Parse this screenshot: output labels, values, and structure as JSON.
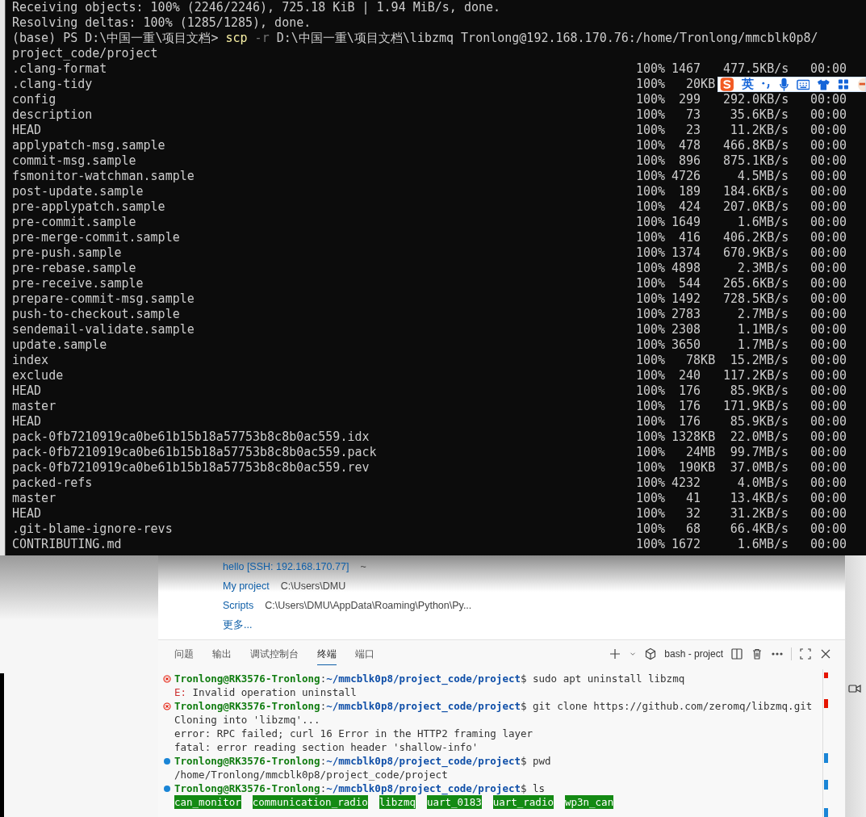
{
  "console": {
    "lines": [
      [
        {
          "kind": "plain",
          "text": "Receiving objects: 100% (2246/2246), 725.18 KiB | 1.94 MiB/s, done."
        }
      ],
      [
        {
          "kind": "plain",
          "text": "Resolving deltas: 100% (1285/1285), done."
        }
      ],
      [
        {
          "kind": "plain",
          "text": "(base) PS D:\\中国一重\\项目文档> "
        },
        {
          "kind": "command",
          "text": "scp"
        },
        {
          "kind": "flag",
          "text": " -r"
        },
        {
          "kind": "plain",
          "text": " D:\\中国一重\\项目文档\\libzmq Tronlong@192.168.170.76:/home/Tronlong/mmcblk0p8/"
        }
      ],
      [
        {
          "kind": "plain",
          "text": "project_code/project"
        }
      ]
    ],
    "transfers": [
      {
        "name": ".clang-format",
        "percent": "100%",
        "size": "1467",
        "speed": "477.5KB/s",
        "eta": "00:00"
      },
      {
        "name": ".clang-tidy",
        "percent": "100%",
        "size": "  20KB"
      },
      {
        "name": "config",
        "percent": "100%",
        "size": " 299",
        "speed": "292.0KB/s",
        "eta": "00:00"
      },
      {
        "name": "description",
        "percent": "100%",
        "size": "  73",
        "speed": "35.6KB/s",
        "eta": "00:00"
      },
      {
        "name": "HEAD",
        "percent": "100%",
        "size": "  23",
        "speed": "11.2KB/s",
        "eta": "00:00"
      },
      {
        "name": "applypatch-msg.sample",
        "percent": "100%",
        "size": " 478",
        "speed": "466.8KB/s",
        "eta": "00:00"
      },
      {
        "name": "commit-msg.sample",
        "percent": "100%",
        "size": " 896",
        "speed": "875.1KB/s",
        "eta": "00:00"
      },
      {
        "name": "fsmonitor-watchman.sample",
        "percent": "100%",
        "size": "4726",
        "speed": "4.5MB/s",
        "eta": "00:00"
      },
      {
        "name": "post-update.sample",
        "percent": "100%",
        "size": " 189",
        "speed": "184.6KB/s",
        "eta": "00:00"
      },
      {
        "name": "pre-applypatch.sample",
        "percent": "100%",
        "size": " 424",
        "speed": "207.0KB/s",
        "eta": "00:00"
      },
      {
        "name": "pre-commit.sample",
        "percent": "100%",
        "size": "1649",
        "speed": "1.6MB/s",
        "eta": "00:00"
      },
      {
        "name": "pre-merge-commit.sample",
        "percent": "100%",
        "size": " 416",
        "speed": "406.2KB/s",
        "eta": "00:00"
      },
      {
        "name": "pre-push.sample",
        "percent": "100%",
        "size": "1374",
        "speed": "670.9KB/s",
        "eta": "00:00"
      },
      {
        "name": "pre-rebase.sample",
        "percent": "100%",
        "size": "4898",
        "speed": "2.3MB/s",
        "eta": "00:00"
      },
      {
        "name": "pre-receive.sample",
        "percent": "100%",
        "size": " 544",
        "speed": "265.6KB/s",
        "eta": "00:00"
      },
      {
        "name": "prepare-commit-msg.sample",
        "percent": "100%",
        "size": "1492",
        "speed": "728.5KB/s",
        "eta": "00:00"
      },
      {
        "name": "push-to-checkout.sample",
        "percent": "100%",
        "size": "2783",
        "speed": "2.7MB/s",
        "eta": "00:00"
      },
      {
        "name": "sendemail-validate.sample",
        "percent": "100%",
        "size": "2308",
        "speed": "1.1MB/s",
        "eta": "00:00"
      },
      {
        "name": "update.sample",
        "percent": "100%",
        "size": "3650",
        "speed": "1.7MB/s",
        "eta": "00:00"
      },
      {
        "name": "index",
        "percent": "100%",
        "size": "  78KB",
        "speed": "15.2MB/s",
        "eta": "00:00"
      },
      {
        "name": "exclude",
        "percent": "100%",
        "size": " 240",
        "speed": "117.2KB/s",
        "eta": "00:00"
      },
      {
        "name": "HEAD",
        "percent": "100%",
        "size": " 176",
        "speed": "85.9KB/s",
        "eta": "00:00"
      },
      {
        "name": "master",
        "percent": "100%",
        "size": " 176",
        "speed": "171.9KB/s",
        "eta": "00:00"
      },
      {
        "name": "HEAD",
        "percent": "100%",
        "size": " 176",
        "speed": "85.9KB/s",
        "eta": "00:00"
      },
      {
        "name": "pack-0fb7210919ca0be61b15b18a57753b8c8b0ac559.idx",
        "percent": "100%",
        "size": "1328KB",
        "speed": "22.0MB/s",
        "eta": "00:00"
      },
      {
        "name": "pack-0fb7210919ca0be61b15b18a57753b8c8b0ac559.pack",
        "percent": "100%",
        "size": "  24MB",
        "speed": "99.7MB/s",
        "eta": "00:00"
      },
      {
        "name": "pack-0fb7210919ca0be61b15b18a57753b8c8b0ac559.rev",
        "percent": "100%",
        "size": " 190KB",
        "speed": "37.0MB/s",
        "eta": "00:00"
      },
      {
        "name": "packed-refs",
        "percent": "100%",
        "size": "4232",
        "speed": "4.0MB/s",
        "eta": "00:00"
      },
      {
        "name": "master",
        "percent": "100%",
        "size": "  41",
        "speed": "13.4KB/s",
        "eta": "00:00"
      },
      {
        "name": "HEAD",
        "percent": "100%",
        "size": "  32",
        "speed": "31.2KB/s",
        "eta": "00:00"
      },
      {
        "name": ".git-blame-ignore-revs",
        "percent": "100%",
        "size": "  68",
        "speed": "66.4KB/s",
        "eta": "00:00"
      },
      {
        "name": "CONTRIBUTING.md",
        "percent": "100%",
        "size": "1672",
        "speed": "1.6MB/s",
        "eta": "00:00"
      }
    ]
  },
  "ime_toolbar": {
    "mode": "英"
  },
  "editor": {
    "recent": [
      {
        "name": "hello [SSH: 192.168.170.77]",
        "path": "~"
      },
      {
        "name": "My project",
        "path": "C:\\Users\\DMU"
      },
      {
        "name": "Scripts",
        "path": "C:\\Users\\DMU\\AppData\\Roaming\\Python\\Py..."
      }
    ],
    "more": "更多...",
    "panel_tabs": [
      {
        "label": "问题",
        "selected": false
      },
      {
        "label": "输出",
        "selected": false
      },
      {
        "label": "调试控制台",
        "selected": false
      },
      {
        "label": "终端",
        "selected": true
      },
      {
        "label": "端口",
        "selected": false
      }
    ],
    "terminal_name": "bash - project",
    "terminal_lines": [
      {
        "kind": "prompt",
        "failed": true,
        "segments": [
          {
            "kind": "user",
            "text": "Tronlong@RK3576-Tronlong"
          },
          {
            "kind": "sep",
            "text": ":"
          },
          {
            "kind": "path",
            "text": "~/mmcblk0p8/project_code/project"
          },
          {
            "kind": "plain",
            "text": "$ sudo apt uninstall libzmq"
          }
        ]
      },
      {
        "kind": "output",
        "segments": [
          {
            "kind": "err",
            "text": "E:"
          },
          {
            "kind": "plain",
            "text": " Invalid operation uninstall"
          }
        ]
      },
      {
        "kind": "prompt",
        "failed": true,
        "segments": [
          {
            "kind": "user",
            "text": "Tronlong@RK3576-Tronlong"
          },
          {
            "kind": "sep",
            "text": ":"
          },
          {
            "kind": "path",
            "text": "~/mmcblk0p8/project_code/project"
          },
          {
            "kind": "plain",
            "text": "$ git clone https://github.com/zeromq/libzmq.git"
          }
        ]
      },
      {
        "kind": "output",
        "segments": [
          {
            "kind": "plain",
            "text": "Cloning into 'libzmq'..."
          }
        ]
      },
      {
        "kind": "output",
        "segments": [
          {
            "kind": "plain",
            "text": "error: RPC failed; curl 16 Error in the HTTP2 framing layer"
          }
        ]
      },
      {
        "kind": "output",
        "segments": [
          {
            "kind": "plain",
            "text": "fatal: error reading section header 'shallow-info'"
          }
        ]
      },
      {
        "kind": "prompt",
        "failed": false,
        "segments": [
          {
            "kind": "user",
            "text": "Tronlong@RK3576-Tronlong"
          },
          {
            "kind": "sep",
            "text": ":"
          },
          {
            "kind": "path",
            "text": "~/mmcblk0p8/project_code/project"
          },
          {
            "kind": "plain",
            "text": "$ pwd"
          }
        ]
      },
      {
        "kind": "output",
        "segments": [
          {
            "kind": "plain",
            "text": "/home/Tronlong/mmcblk0p8/project_code/project"
          }
        ]
      },
      {
        "kind": "prompt",
        "failed": false,
        "segments": [
          {
            "kind": "user",
            "text": "Tronlong@RK3576-Tronlong"
          },
          {
            "kind": "sep",
            "text": ":"
          },
          {
            "kind": "path",
            "text": "~/mmcblk0p8/project_code/project"
          },
          {
            "kind": "plain",
            "text": "$ ls"
          }
        ]
      },
      {
        "kind": "output",
        "segments": [
          {
            "kind": "dir",
            "text": "can_monitor"
          },
          {
            "kind": "dir",
            "text": "communication_radio"
          },
          {
            "kind": "dir",
            "text": "libzmq"
          },
          {
            "kind": "dir",
            "text": "uart_0183"
          },
          {
            "kind": "dir",
            "text": "uart_radio"
          },
          {
            "kind": "dir",
            "text": "wp3n_can"
          }
        ]
      }
    ]
  }
}
